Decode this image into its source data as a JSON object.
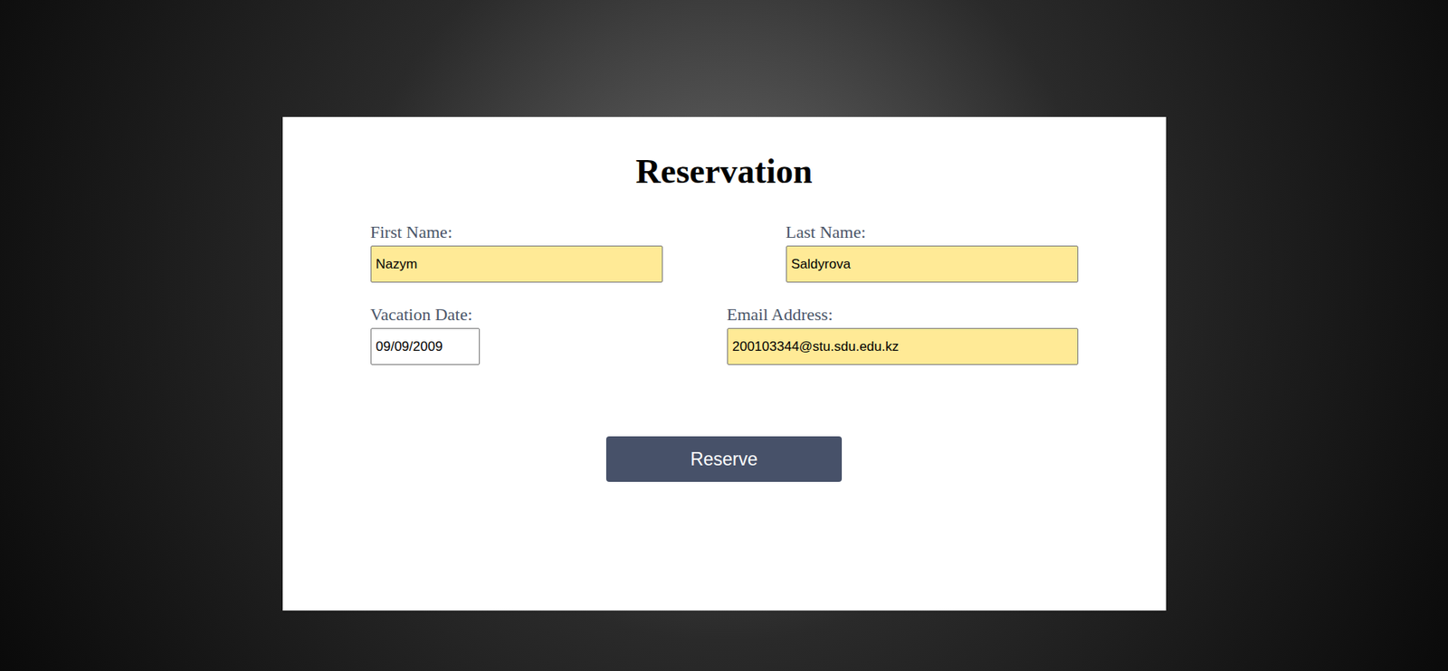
{
  "form": {
    "title": "Reservation",
    "fields": [
      {
        "label": "First Name:",
        "value": "Nazym",
        "autofilled": true
      },
      {
        "label": "Last Name:",
        "value": "Saldyrova",
        "autofilled": true
      },
      {
        "label": "Vacation Date:",
        "value": "09/09/2009",
        "autofilled": false
      },
      {
        "label": "Email Address:",
        "value": "200103344@stu.sdu.edu.kz",
        "autofilled": true
      }
    ],
    "button": "Reserve"
  }
}
